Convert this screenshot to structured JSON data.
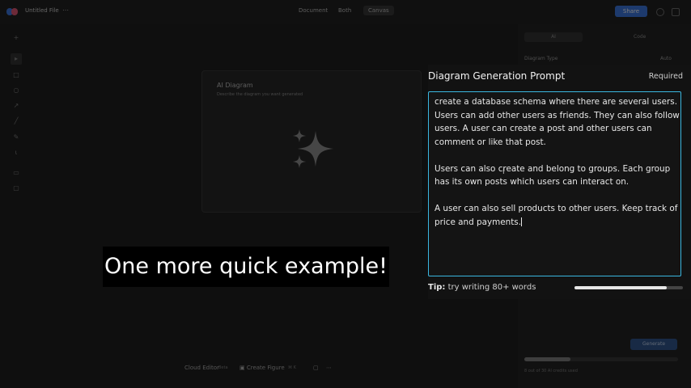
{
  "topbar": {
    "file_title": "Untitled File",
    "menu_glyph": "⋯",
    "tabs": [
      "Document",
      "Both",
      "Canvas"
    ],
    "share_label": "Share"
  },
  "left_toolbar": {
    "icons": [
      "cursor-icon",
      "rectangle-icon",
      "circle-icon",
      "arrow-icon",
      "line-icon",
      "pen-icon",
      "text-icon",
      "frame-icon",
      "comment-icon"
    ]
  },
  "canvas_card": {
    "title": "AI Diagram",
    "subtitle": "Describe the diagram you want generated",
    "icon": "sparkles-icon"
  },
  "right_panel": {
    "tabs": [
      "AI",
      "Code"
    ],
    "diagram_type_label": "Diagram Type",
    "diagram_type_value": "Auto",
    "generate_label": "Generate",
    "usage_fraction": 0.3,
    "footer": "8 out of 30 AI credits used"
  },
  "prompt_panel": {
    "title": "Diagram Generation Prompt",
    "required_label": "Required",
    "paragraphs": [
      "create a database schema where there are several users. Users can add other users as friends. They can also follow users. A user can create a post and other users can comment or like that post.",
      "Users can also create and belong to groups. Each group has its own posts which users can interact on.",
      "A user can also sell products to other users. Keep track of price and payments."
    ],
    "tip_bold": "Tip:",
    "tip_text": " try writing 80+ words",
    "word_progress": 0.85
  },
  "bottom_bar": {
    "items": [
      "Cloud Editor",
      "Create Figure"
    ],
    "badges": [
      "Beta",
      "⌘ K"
    ]
  },
  "caption": "One more quick example!",
  "colors": {
    "accent_border": "#3ab7e0",
    "share_blue": "#2f6fe0",
    "background": "#0f0f0f"
  }
}
